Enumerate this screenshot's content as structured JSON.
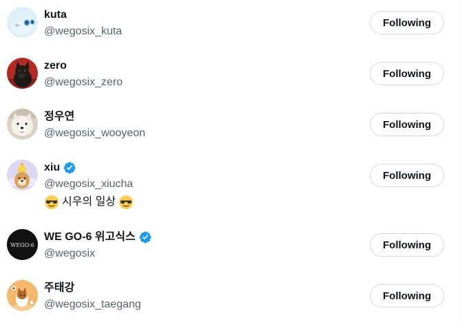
{
  "accent_color": "#1d9bf0",
  "users": [
    {
      "name": "kuta",
      "handle": "@wegosix_kuta",
      "verified": false,
      "button_label": "Following"
    },
    {
      "name": "zero",
      "handle": "@wegosix_zero",
      "verified": false,
      "button_label": "Following"
    },
    {
      "name": "정우연",
      "handle": "@wegosix_wooyeon",
      "verified": false,
      "button_label": "Following"
    },
    {
      "name": "xiu",
      "handle": "@wegosix_xiucha",
      "verified": true,
      "bio_text": "시우의 일상",
      "bio_emoji": "sunglasses-emoji",
      "button_label": "Following"
    },
    {
      "name": "WE GO-6 위고식스",
      "handle": "@wegosix",
      "verified": true,
      "avatar_text": "WEGO·6",
      "button_label": "Following"
    },
    {
      "name": "주태강",
      "handle": "@wegosix_taegang",
      "verified": false,
      "button_label": "Following"
    }
  ]
}
